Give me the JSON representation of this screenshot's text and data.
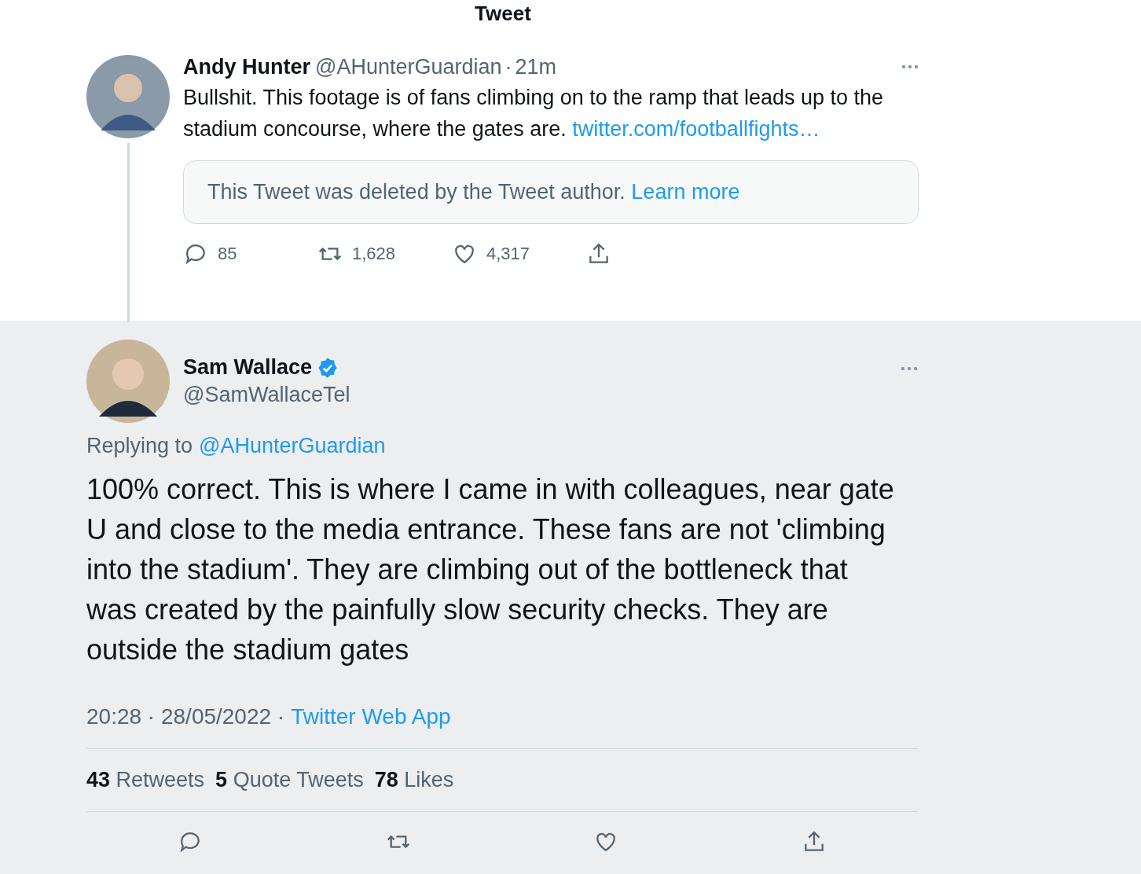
{
  "header": {
    "title": "Tweet"
  },
  "parent_tweet": {
    "name": "Andy Hunter",
    "handle": "@AHunterGuardian",
    "separator": "·",
    "time": "21m",
    "text": "Bullshit. This footage is of fans climbing on to the ramp that leads up to the stadium concourse, where the gates are.",
    "link": "twitter.com/footballfights…",
    "quote": {
      "text": "This Tweet was deleted by the Tweet author.",
      "link": "Learn more"
    },
    "actions": [
      {
        "kind": "reply",
        "count": "85"
      },
      {
        "kind": "retweet",
        "count": "1,628"
      },
      {
        "kind": "like",
        "count": "4,317"
      },
      {
        "kind": "share"
      }
    ]
  },
  "main_tweet": {
    "name": "Sam Wallace",
    "verified": true,
    "handle": "@SamWallaceTel",
    "replying_label": "Replying to",
    "replying_to": "@AHunterGuardian",
    "text": "100% correct. This is where I came in with colleagues, near gate U and close to the media entrance. These fans are not 'climbing into the stadium'. They are climbing out of the bottleneck that was created by the painfully slow security checks. They are outside the stadium gates",
    "meta": "20:28 · 28/05/2022 ·",
    "source": "Twitter Web App",
    "stats": [
      {
        "count": "43",
        "label": "Retweets"
      },
      {
        "count": "5",
        "label": "Quote Tweets"
      },
      {
        "count": "78",
        "label": "Likes"
      }
    ],
    "actions": [
      {
        "kind": "reply"
      },
      {
        "kind": "retweet"
      },
      {
        "kind": "like"
      },
      {
        "kind": "share"
      }
    ]
  }
}
